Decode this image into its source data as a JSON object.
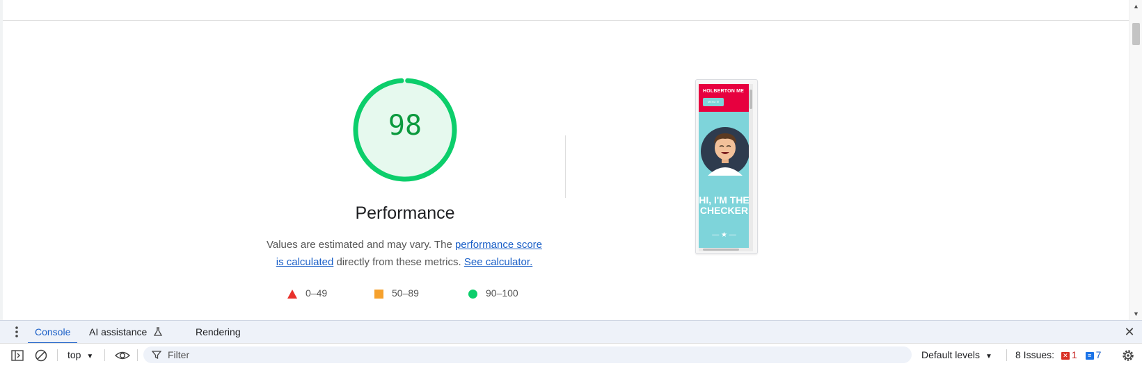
{
  "report": {
    "score": "98",
    "category": "Performance",
    "desc_before": "Values are estimated and may vary. The ",
    "desc_link1": "performance score is calculated",
    "desc_mid": " directly from these metrics. ",
    "desc_link2": "See calculator.",
    "legend": [
      {
        "label": "0–49",
        "color": "#e8312b",
        "shape": "triangle"
      },
      {
        "label": "50–89",
        "color": "#f6a12d",
        "shape": "square"
      },
      {
        "label": "90–100",
        "color": "#0cce6b",
        "shape": "circle"
      }
    ],
    "gauge_fraction": 0.98,
    "gauge_color": "#0cce6b"
  },
  "thumbnail": {
    "brand": "HOLBERTON ME",
    "menu": "MENU ☰",
    "headline": "HI, I'M THE CHECKER",
    "header_color": "#e7003f",
    "bg_color": "#7ed4da"
  },
  "devtools": {
    "tabs": [
      {
        "label": "Console",
        "active": true
      },
      {
        "label": "AI assistance",
        "active": false
      },
      {
        "label": "Rendering",
        "active": false
      }
    ],
    "context": "top",
    "filter_placeholder": "Filter",
    "levels": "Default levels",
    "issues_label": "8 Issues:",
    "issues_errors": "1",
    "issues_info": "7",
    "icons": [
      "more-vert-icon",
      "flask-icon",
      "close-icon",
      "sidebar-toggle-icon",
      "clear-console-icon",
      "dropdown-arrow-icon",
      "eye-icon",
      "filter-icon",
      "settings-icon"
    ]
  }
}
